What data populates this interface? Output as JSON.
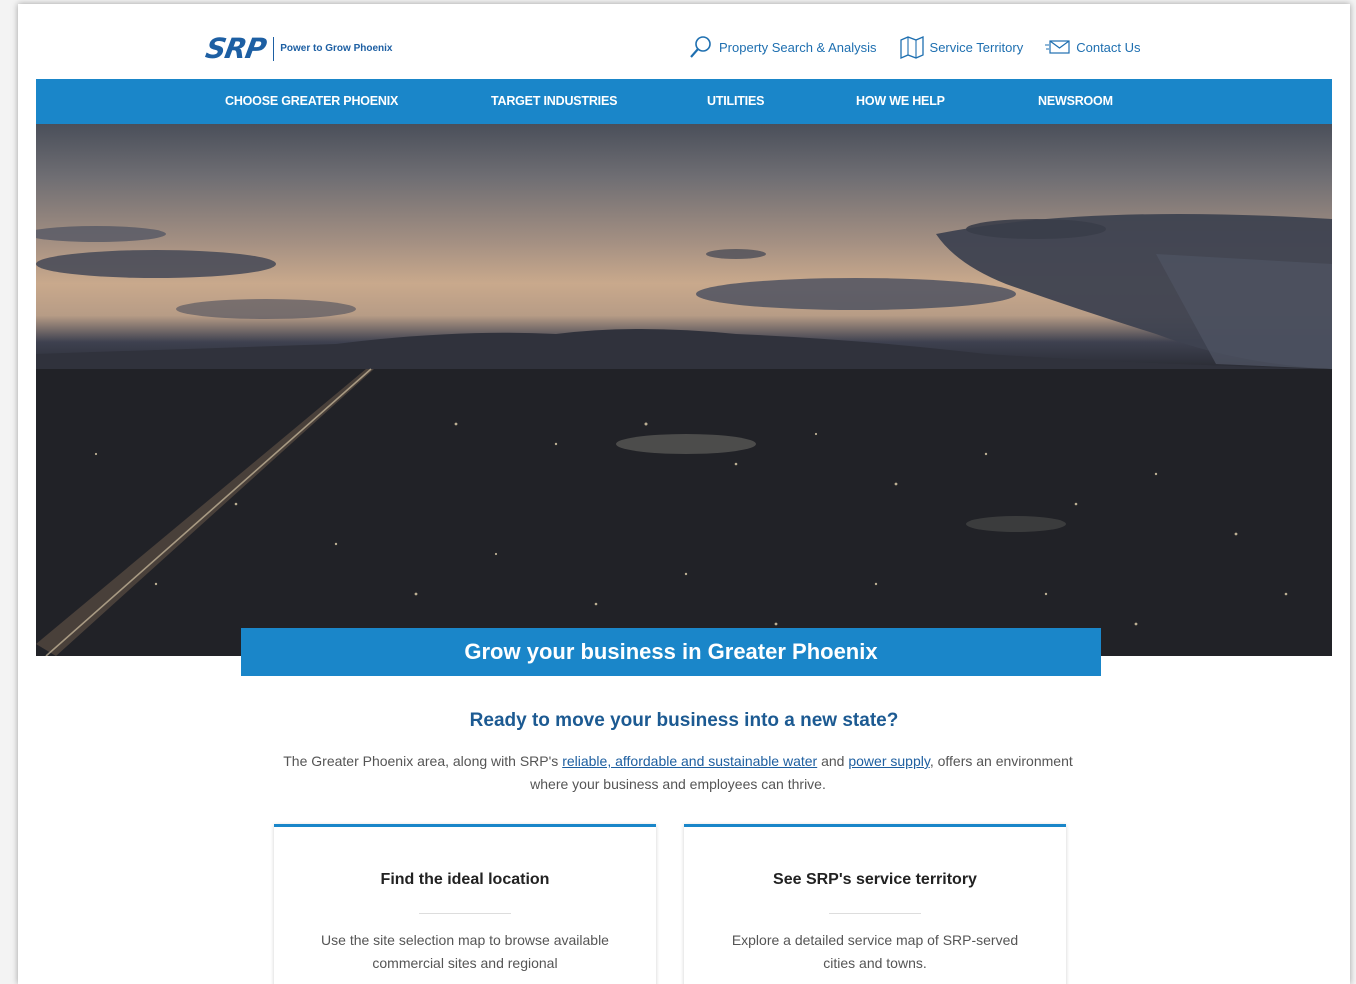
{
  "header": {
    "logo_text": "SRP",
    "tagline": "Power to Grow Phoenix",
    "util_links": [
      {
        "label": "Property Search & Analysis",
        "icon": "search-icon"
      },
      {
        "label": "Service Territory",
        "icon": "map-icon"
      },
      {
        "label": "Contact Us",
        "icon": "envelope-icon"
      }
    ]
  },
  "nav": {
    "items": [
      {
        "label": "CHOOSE GREATER PHOENIX"
      },
      {
        "label": "TARGET INDUSTRIES"
      },
      {
        "label": "UTILITIES"
      },
      {
        "label": "HOW WE HELP"
      },
      {
        "label": "NEWSROOM"
      }
    ]
  },
  "hero": {
    "banner": "Grow your business in Greater Phoenix"
  },
  "intro": {
    "title": "Ready to move your business into a new state?",
    "text_1": "The Greater Phoenix area, along with SRP's ",
    "link_1": "reliable, affordable and sustainable water",
    "text_2": " and ",
    "link_2": "power supply",
    "text_3": ", offers an environment where your business and employees can thrive."
  },
  "cards": [
    {
      "title": "Find the ideal location",
      "text": "Use the site selection map to browse available commercial sites and regional"
    },
    {
      "title": "See SRP's service territory",
      "text": "Explore a detailed service map of SRP-served cities and towns."
    }
  ],
  "colors": {
    "brand_blue": "#1a86c9",
    "heading_blue": "#1c5a92"
  }
}
